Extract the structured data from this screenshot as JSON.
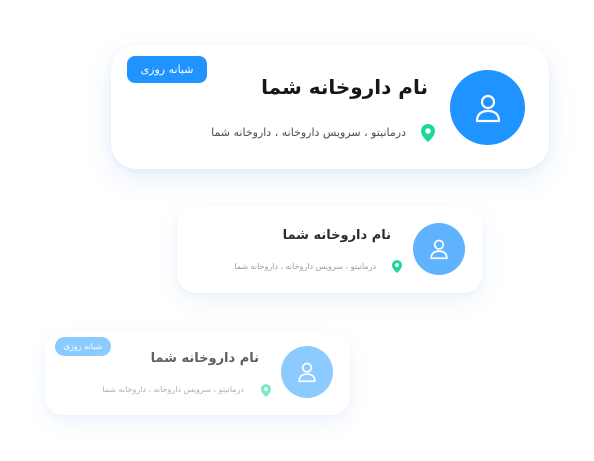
{
  "colors": {
    "primary_blue": "#1f93ff",
    "medium_blue": "#5fb2fd",
    "light_blue": "#8ccbff",
    "pin_green": "#1ed79a",
    "pin_green_faded": "#7fe8c2"
  },
  "cards": [
    {
      "title": "نام داروخانه شما",
      "address": "درمانیتو ، سرویس داروخانه ، داروخانه شما",
      "badge": "شبانه روزی",
      "avatar_icon": "user-icon",
      "location_icon": "location-pin-icon"
    },
    {
      "title": "نام داروخانه شما",
      "address": "درمانیتو ، سرویس داروخانه ، داروخانه شما",
      "avatar_icon": "user-icon",
      "location_icon": "location-pin-icon"
    },
    {
      "title": "نام داروخانه شما",
      "address": "درمانیتو ، سرویس داروخانه ، داروخانه شما",
      "badge": "شبانه روزی",
      "avatar_icon": "user-icon",
      "location_icon": "location-pin-icon"
    }
  ]
}
